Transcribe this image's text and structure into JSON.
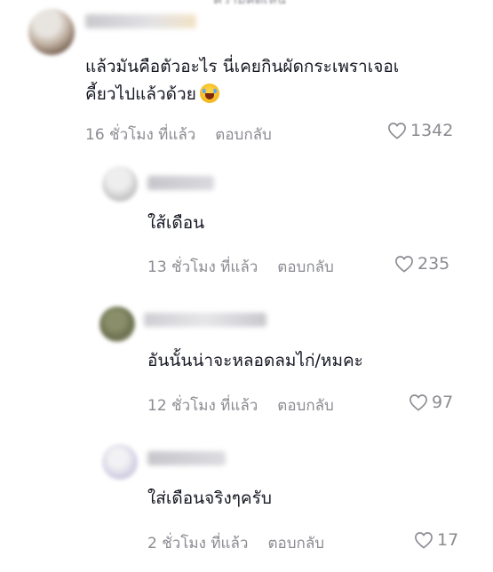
{
  "comments": [
    {
      "text_line1": "แล้วมันคือตัวอะไร นี่เคยกินผัดกระเพราเจอเ",
      "text_line2": "คี้ยวไปแล้วด้วย",
      "emoji": "loudly-crying-emoji",
      "time": "16 ชั่วโมง ที่แล้ว",
      "reply": "ตอบกลับ",
      "likes": "1342"
    },
    {
      "text": "ใส้เดือน",
      "time": "13 ชั่วโมง ที่แล้ว",
      "reply": "ตอบกลับ",
      "likes": "235"
    },
    {
      "text": "อันนั้นน่าจะหลอดลมไก่/หมคะ",
      "time": "12 ชั่วโมง ที่แล้ว",
      "reply": "ตอบกลับ",
      "likes": "97"
    },
    {
      "text": "ใส่เดือนจริงๆครับ",
      "time": "2 ชั่วโมง ที่แล้ว",
      "reply": "ตอบกลับ",
      "likes": "17"
    }
  ],
  "icons": {
    "like": "heart-outline-icon"
  },
  "colors": {
    "text": "#161823",
    "secondary": "#8a8b91",
    "background": "#ffffff"
  }
}
